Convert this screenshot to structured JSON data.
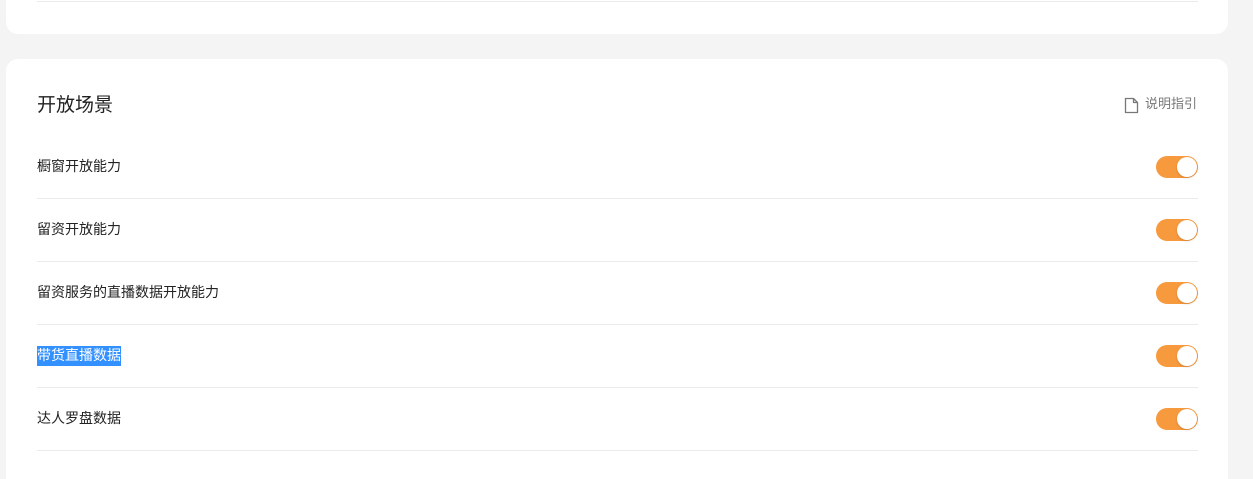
{
  "section": {
    "title": "开放场景",
    "guide_label": "说明指引"
  },
  "rows": [
    {
      "label": "橱窗开放能力",
      "enabled": true,
      "selected": false
    },
    {
      "label": "留资开放能力",
      "enabled": true,
      "selected": false
    },
    {
      "label": "留资服务的直播数据开放能力",
      "enabled": true,
      "selected": false
    },
    {
      "label": "带货直播数据",
      "enabled": true,
      "selected": true
    },
    {
      "label": "达人罗盘数据",
      "enabled": true,
      "selected": false
    }
  ],
  "colors": {
    "toggle_on": "#f7993d",
    "selection": "#3390ff"
  },
  "icons": {
    "guide": "document-icon"
  }
}
